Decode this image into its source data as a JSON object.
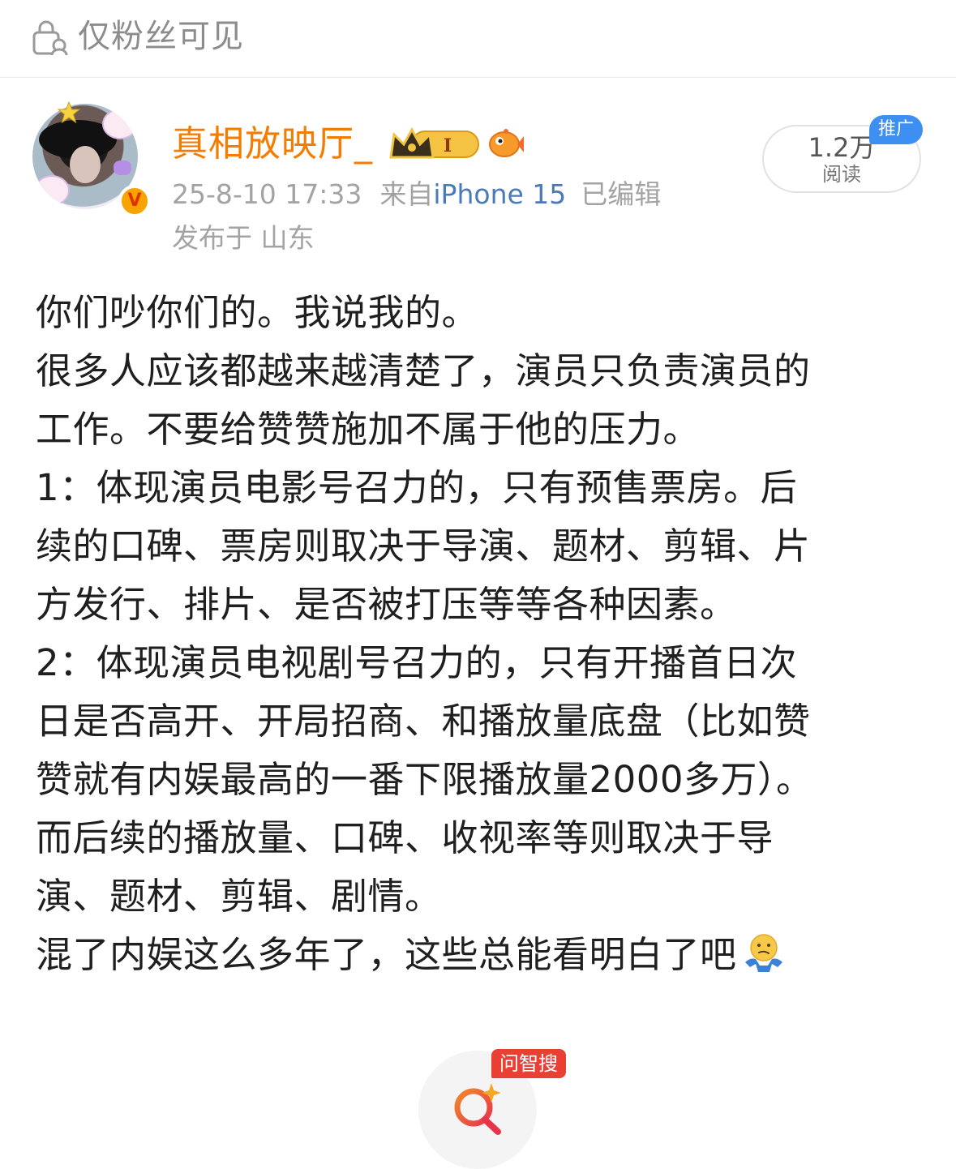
{
  "visibility": {
    "label": "仅粉丝可见",
    "icon": "lock-people-icon"
  },
  "author": {
    "name": "真相放映厅_",
    "verified_badge": "V",
    "member_badge": "I",
    "accent_color": "#f47c00"
  },
  "meta": {
    "timestamp": "25-8-10 17:33",
    "source_prefix": "来自",
    "device": "iPhone 15",
    "edited": "已编辑",
    "location": "发布于 山东"
  },
  "reads": {
    "count": "1.2万",
    "label": "阅读",
    "promo": "推广"
  },
  "post": {
    "lines": [
      "你们吵你们的。我说我的。",
      "很多人应该都越来越清楚了，演员只负责演员的",
      "工作。不要给赞赞施加不属于他的压力。",
      "1：体现演员电影号召力的，只有预售票房。后",
      "续的口碑、票房则取决于导演、题材、剪辑、片",
      "方发行、排片、是否被打压等等各种因素。",
      "2：体现演员电视剧号召力的，只有开播首日次",
      "日是否高开、开局招商、和播放量底盘（比如赞",
      "赞就有内娱最高的一番下限播放量2000多万）。",
      "而后续的播放量、口碑、收视率等则取决于导",
      "演、题材、剪辑、剧情。",
      "混了内娱这么多年了，这些总能看明白了吧"
    ],
    "trailing_emoji": "shrug-emoji"
  },
  "fab": {
    "tag": "问智搜",
    "icon": "smart-search-icon"
  }
}
